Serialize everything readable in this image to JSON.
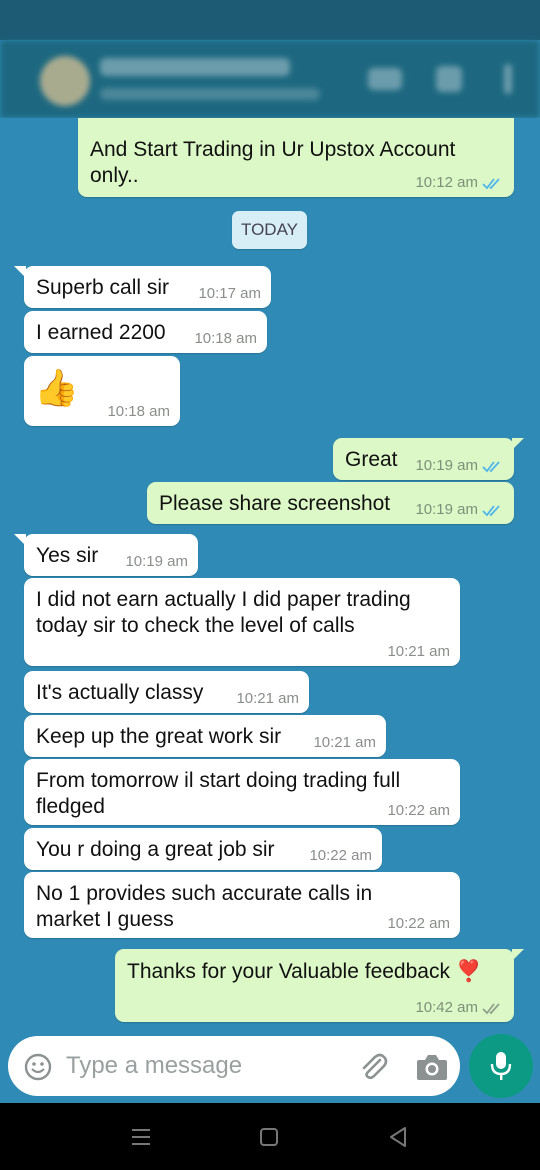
{
  "date_divider": "TODAY",
  "messages": [
    {
      "dir": "out",
      "text": "And Start Trading in Ur Upstox Account only..",
      "time": "10:12 am",
      "ticks": "read"
    },
    {
      "dir": "in",
      "text": "Superb call sir",
      "time": "10:17 am"
    },
    {
      "dir": "in",
      "text": "I earned 2200",
      "time": "10:18 am"
    },
    {
      "dir": "in",
      "text": "👍",
      "time": "10:18 am"
    },
    {
      "dir": "out",
      "text": "Great",
      "time": "10:19 am",
      "ticks": "read"
    },
    {
      "dir": "out",
      "text": "Please share screenshot",
      "time": "10:19 am",
      "ticks": "read"
    },
    {
      "dir": "in",
      "text": "Yes sir",
      "time": "10:19 am"
    },
    {
      "dir": "in",
      "text": "I did not earn actually I did paper trading today sir to check the level of calls",
      "time": "10:21 am"
    },
    {
      "dir": "in",
      "text": "It's actually classy",
      "time": "10:21 am"
    },
    {
      "dir": "in",
      "text": "Keep up the great work sir",
      "time": "10:21 am"
    },
    {
      "dir": "in",
      "text": "From tomorrow il start doing trading full fledged",
      "time": "10:22 am"
    },
    {
      "dir": "in",
      "text": "You r doing a great job sir",
      "time": "10:22 am"
    },
    {
      "dir": "in",
      "text": "No 1 provides such accurate calls in market I guess",
      "time": "10:22 am"
    },
    {
      "dir": "out",
      "text": "Thanks for your Valuable feedback ❣️",
      "time": "10:42 am",
      "ticks": "sent"
    }
  ],
  "composer": {
    "placeholder": "Type a message"
  },
  "icons": {
    "emoji": "emoji-icon",
    "attach": "paperclip-icon",
    "camera": "camera-icon",
    "mic": "mic-icon"
  },
  "colors": {
    "chat_bg": "#2f8bb5",
    "out_bubble": "#dcf8c6",
    "in_bubble": "#ffffff",
    "read_tick": "#4fb6ec",
    "mic_button": "#0c9a85"
  }
}
